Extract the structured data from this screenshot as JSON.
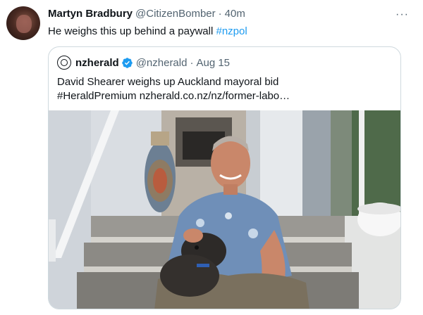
{
  "tweet": {
    "author_name": "Martyn Bradbury",
    "author_handle": "@CitizenBomber",
    "separator": "·",
    "time": "40m",
    "more_label": "···",
    "text_prefix": "He weighs this up behind a paywall ",
    "hashtag": "#nzpol"
  },
  "quote": {
    "author_name": "nzherald",
    "author_handle": "@nzherald",
    "separator": "·",
    "date": "Aug 15",
    "line1": "David Shearer weighs up Auckland mayoral bid",
    "line2": "#HeraldPremium nzherald.co.nz/nz/former-labo…"
  },
  "colors": {
    "link": "#1d9bf0",
    "muted": "#536471",
    "verified": "#1d9bf0",
    "border": "#cfd9de"
  },
  "icons": {
    "avatar": "avatar-image",
    "more": "more-icon",
    "logo": "nzherald-logo-icon",
    "verified": "verified-badge-icon"
  }
}
